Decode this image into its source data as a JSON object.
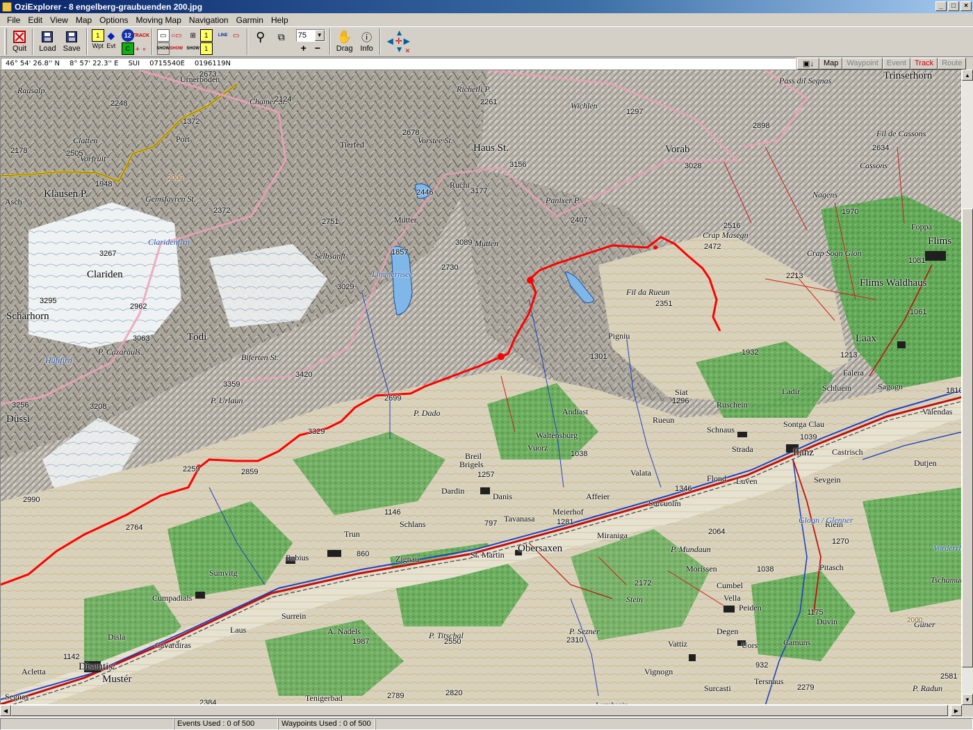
{
  "window": {
    "title": "OziExplorer - 8 engelberg-graubuenden 200.jpg",
    "buttons": [
      "_",
      "□",
      "×"
    ]
  },
  "menu": [
    "File",
    "Edit",
    "View",
    "Map",
    "Options",
    "Moving Map",
    "Navigation",
    "Garmin",
    "Help"
  ],
  "toolbar": {
    "quit": "Quit",
    "load": "Load",
    "save": "Save",
    "wpt": "Wpt",
    "evt": "Evt",
    "track_badge": "TRACK",
    "show": "SHOW",
    "line": "LINE",
    "waypoint_number": "12",
    "zoom_value": "75",
    "drag": "Drag",
    "info": "Info"
  },
  "position": {
    "lat": "46° 54' 26.8'' N",
    "lon": "8° 57' 22.3'' E",
    "grid": "SUI",
    "easting": "0715540E",
    "northing": "0196119N"
  },
  "mode_tabs": {
    "map": "Map",
    "waypoint": "Waypoint",
    "event": "Event",
    "track": "Track",
    "route": "Route"
  },
  "status": {
    "events_used": "Events Used : 0 of 500",
    "waypoints_used": "Waypoints Used : 0 of 500"
  },
  "colors": {
    "track": "#ff0000",
    "road": "#c01010",
    "river": "#2040c0",
    "forest": "#5aa850",
    "rock": "#b8b4ac",
    "glacier": "#e8eef0"
  },
  "map": {
    "places": [
      {
        "name": "Urnerboden",
        "kind": "place"
      },
      {
        "name": "Chamer St.",
        "kind": "italic"
      },
      {
        "name": "Rausalp",
        "kind": "italic"
      },
      {
        "name": "Port",
        "kind": "place"
      },
      {
        "name": "Clatten",
        "kind": "italic"
      },
      {
        "name": "Vorfruit",
        "kind": "italic"
      },
      {
        "name": "Klausen P.",
        "kind": "big"
      },
      {
        "name": "Gemsfayren St.",
        "kind": "italic"
      },
      {
        "name": "Asch",
        "kind": "place"
      },
      {
        "name": "Tierfed",
        "kind": "place"
      },
      {
        "name": "Richetli P.",
        "kind": "italic"
      },
      {
        "name": "Vorstee St.",
        "kind": "italic"
      },
      {
        "name": "Haus St.",
        "kind": "big"
      },
      {
        "name": "Wichlen",
        "kind": "italic"
      },
      {
        "name": "Vorab",
        "kind": "big"
      },
      {
        "name": "Pass dil Segnas",
        "kind": "italic"
      },
      {
        "name": "Trinserhorn",
        "kind": "big"
      },
      {
        "name": "Fil de Cassons",
        "kind": "italic"
      },
      {
        "name": "Cassons",
        "kind": "italic"
      },
      {
        "name": "Nagens",
        "kind": "italic"
      },
      {
        "name": "Foppa",
        "kind": "place"
      },
      {
        "name": "Flims",
        "kind": "big"
      },
      {
        "name": "Flims Waldhaus",
        "kind": "big"
      },
      {
        "name": "Crap Masegn",
        "kind": "italic"
      },
      {
        "name": "Crap Sogn Gion",
        "kind": "italic"
      },
      {
        "name": "Panixer P.",
        "kind": "italic"
      },
      {
        "name": "Ruchi",
        "kind": "place"
      },
      {
        "name": "Mutten",
        "kind": "italic"
      },
      {
        "name": "Mutter",
        "kind": "place"
      },
      {
        "name": "Selbsanft",
        "kind": "italic"
      },
      {
        "name": "Limmernsee",
        "kind": "blue"
      },
      {
        "name": "Clariden",
        "kind": "big"
      },
      {
        "name": "Schärhorn",
        "kind": "big"
      },
      {
        "name": "Claridenfirn",
        "kind": "blue"
      },
      {
        "name": "Hüfifirn",
        "kind": "blue"
      },
      {
        "name": "Tödi",
        "kind": "big"
      },
      {
        "name": "P. Cazarauls",
        "kind": "italic"
      },
      {
        "name": "Biferten St.",
        "kind": "italic"
      },
      {
        "name": "Düssi",
        "kind": "big"
      },
      {
        "name": "P. Urlaun",
        "kind": "italic"
      },
      {
        "name": "P. Dado",
        "kind": "italic"
      },
      {
        "name": "Fil da Rueun",
        "kind": "italic"
      },
      {
        "name": "Pigniu",
        "kind": "place"
      },
      {
        "name": "Laax",
        "kind": "big"
      },
      {
        "name": "Falera",
        "kind": "place"
      },
      {
        "name": "Schluein",
        "kind": "place"
      },
      {
        "name": "Sagogn",
        "kind": "place"
      },
      {
        "name": "Valendas",
        "kind": "place"
      },
      {
        "name": "Ladir",
        "kind": "place"
      },
      {
        "name": "Ruschein",
        "kind": "place"
      },
      {
        "name": "Siat",
        "kind": "place"
      },
      {
        "name": "Andiast",
        "kind": "place"
      },
      {
        "name": "Rueun",
        "kind": "place"
      },
      {
        "name": "Schnaus",
        "kind": "place"
      },
      {
        "name": "Sontga Clau",
        "kind": "place"
      },
      {
        "name": "Strada",
        "kind": "place"
      },
      {
        "name": "Ilanz",
        "kind": "big"
      },
      {
        "name": "Castrisch",
        "kind": "place"
      },
      {
        "name": "Dutjen",
        "kind": "place"
      },
      {
        "name": "Sevgein",
        "kind": "place"
      },
      {
        "name": "Waltensburg",
        "kind": "place"
      },
      {
        "name": "Vuorz",
        "kind": "place"
      },
      {
        "name": "Breil",
        "kind": "place"
      },
      {
        "name": "Brigels",
        "kind": "place"
      },
      {
        "name": "Dardin",
        "kind": "place"
      },
      {
        "name": "Danis",
        "kind": "place"
      },
      {
        "name": "Valata",
        "kind": "place"
      },
      {
        "name": "Flond",
        "kind": "place"
      },
      {
        "name": "Luven",
        "kind": "place"
      },
      {
        "name": "Affeier",
        "kind": "place"
      },
      {
        "name": "Surcuolm",
        "kind": "place"
      },
      {
        "name": "Meierhof",
        "kind": "place"
      },
      {
        "name": "Tavanasa",
        "kind": "place"
      },
      {
        "name": "Schlans",
        "kind": "place"
      },
      {
        "name": "Trun",
        "kind": "place"
      },
      {
        "name": "Zignau",
        "kind": "place"
      },
      {
        "name": "St. Martin",
        "kind": "place"
      },
      {
        "name": "Obersaxen",
        "kind": "big"
      },
      {
        "name": "Miraniga",
        "kind": "place"
      },
      {
        "name": "P. Mundaun",
        "kind": "italic"
      },
      {
        "name": "Morissen",
        "kind": "place"
      },
      {
        "name": "Cumbel",
        "kind": "place"
      },
      {
        "name": "Vella",
        "kind": "place"
      },
      {
        "name": "Peiden",
        "kind": "place"
      },
      {
        "name": "Riein",
        "kind": "place"
      },
      {
        "name": "Pitasch",
        "kind": "place"
      },
      {
        "name": "Duvin",
        "kind": "place"
      },
      {
        "name": "Güner",
        "kind": "italic"
      },
      {
        "name": "Rabius",
        "kind": "place"
      },
      {
        "name": "Sumvitg",
        "kind": "place"
      },
      {
        "name": "Cumpadials",
        "kind": "place"
      },
      {
        "name": "Surrein",
        "kind": "place"
      },
      {
        "name": "Disla",
        "kind": "place"
      },
      {
        "name": "Cavardiras",
        "kind": "place"
      },
      {
        "name": "Laus",
        "kind": "place"
      },
      {
        "name": "A. Nadels",
        "kind": "place"
      },
      {
        "name": "P. Titschal",
        "kind": "italic"
      },
      {
        "name": "P. Sezner",
        "kind": "italic"
      },
      {
        "name": "Degen",
        "kind": "place"
      },
      {
        "name": "Vattiz",
        "kind": "place"
      },
      {
        "name": "Vignogn",
        "kind": "place"
      },
      {
        "name": "Uors",
        "kind": "place"
      },
      {
        "name": "Camuns",
        "kind": "place"
      },
      {
        "name": "Surcasti",
        "kind": "place"
      },
      {
        "name": "Tersnaus",
        "kind": "place"
      },
      {
        "name": "Disentis/",
        "kind": "big"
      },
      {
        "name": "Mustér",
        "kind": "big"
      },
      {
        "name": "Acletta",
        "kind": "place"
      },
      {
        "name": "Segnas",
        "kind": "place"
      },
      {
        "name": "Tenigerbad",
        "kind": "place"
      },
      {
        "name": "Lumbrein",
        "kind": "place"
      },
      {
        "name": "P. Radun",
        "kind": "italic"
      },
      {
        "name": "Glogn / Glenner",
        "kind": "blue"
      },
      {
        "name": "Vorderrhein",
        "kind": "blue"
      },
      {
        "name": "Stein",
        "kind": "italic"
      },
      {
        "name": "Tschamut",
        "kind": "italic"
      }
    ],
    "heights": [
      "2673",
      "2248",
      "2124",
      "1372",
      "2178",
      "2505",
      "1948",
      "2006",
      "2372",
      "3267",
      "3295",
      "2962",
      "3063",
      "3359",
      "3256",
      "3208",
      "2990",
      "2764",
      "2259",
      "2859",
      "2699",
      "3329",
      "3420",
      "2751",
      "3029",
      "1857",
      "2446",
      "2678",
      "2261",
      "1297",
      "2898",
      "2634",
      "3156",
      "3177",
      "2407",
      "3028",
      "2516",
      "2472",
      "1970",
      "1081",
      "2213",
      "1061",
      "3089",
      "2730",
      "2351",
      "1301",
      "1932",
      "1213",
      "1296",
      "1810",
      "1039",
      "1038",
      "1257",
      "1146",
      "797",
      "1281",
      "1346",
      "2064",
      "2172",
      "1038",
      "1270",
      "1175",
      "860",
      "2310",
      "1987",
      "2550",
      "1142",
      "2384",
      "2820",
      "2789",
      "2279",
      "932",
      "2581",
      "2000"
    ]
  }
}
